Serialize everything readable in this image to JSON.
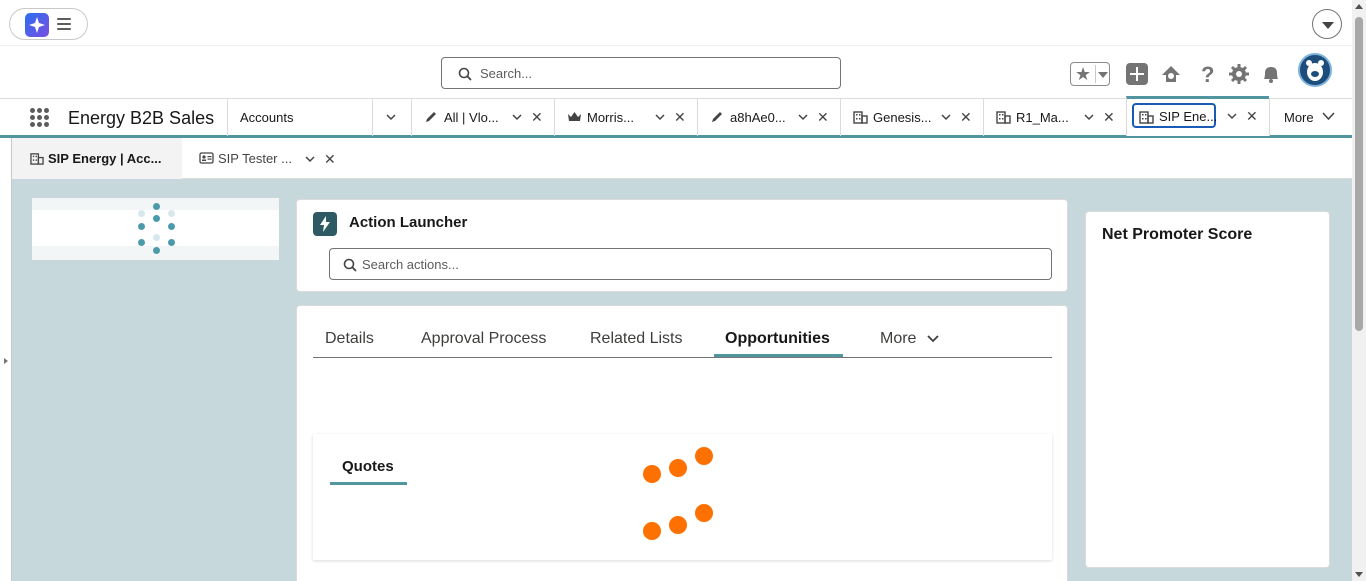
{
  "header": {
    "search_placeholder": "Search..."
  },
  "nav": {
    "app_name": "Energy B2B Sales",
    "tabs": [
      {
        "label": "Accounts",
        "icon": "none"
      },
      {
        "label": "All | Vlo...",
        "icon": "pencil-icon"
      },
      {
        "label": "Morris...",
        "icon": "crown-icon"
      },
      {
        "label": "a8hAe0...",
        "icon": "pencil-icon"
      },
      {
        "label": "Genesis...",
        "icon": "building-icon"
      },
      {
        "label": "R1_Ma...",
        "icon": "building-icon"
      },
      {
        "label": "SIP Ene...",
        "icon": "building-icon"
      }
    ],
    "more_label": "More"
  },
  "subtabs": [
    {
      "label": "SIP Energy | Acc...",
      "icon": "building-icon"
    },
    {
      "label": "SIP Tester ...",
      "icon": "contact-card-icon"
    }
  ],
  "action_launcher": {
    "title": "Action Launcher",
    "search_placeholder": "Search actions..."
  },
  "record_tabs": {
    "items": [
      "Details",
      "Approval Process",
      "Related Lists",
      "Opportunities"
    ],
    "active": "Opportunities",
    "more_label": "More"
  },
  "quotes": {
    "label": "Quotes"
  },
  "nps": {
    "title": "Net Promoter Score"
  },
  "colors": {
    "accent": "#5195a1",
    "workspace_bg": "#c6d8db",
    "loading_orange": "#fe7000",
    "focus_blue": "#1b5bb8"
  }
}
